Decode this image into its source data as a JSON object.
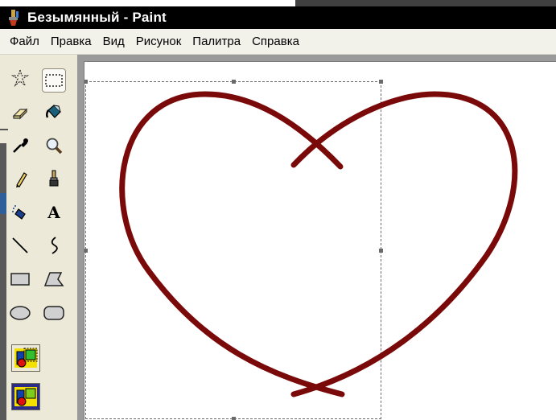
{
  "window": {
    "title": "Безымянный - Paint",
    "app_icon": "paint-icon"
  },
  "menu": {
    "items": [
      "Файл",
      "Правка",
      "Вид",
      "Рисунок",
      "Палитра",
      "Справка"
    ]
  },
  "toolbox": {
    "tools": [
      {
        "name": "free-form-select-icon",
        "selected": false
      },
      {
        "name": "rectangle-select-icon",
        "selected": true
      },
      {
        "name": "eraser-icon",
        "selected": false
      },
      {
        "name": "fill-bucket-icon",
        "selected": false
      },
      {
        "name": "color-picker-icon",
        "selected": false
      },
      {
        "name": "magnifier-icon",
        "selected": false
      },
      {
        "name": "pencil-icon",
        "selected": false
      },
      {
        "name": "brush-icon",
        "selected": false
      },
      {
        "name": "airbrush-icon",
        "selected": false
      },
      {
        "name": "text-tool-icon",
        "selected": false
      },
      {
        "name": "line-icon",
        "selected": false
      },
      {
        "name": "curve-icon",
        "selected": false
      },
      {
        "name": "rectangle-icon",
        "selected": false
      },
      {
        "name": "polygon-icon",
        "selected": false
      },
      {
        "name": "ellipse-icon",
        "selected": false
      },
      {
        "name": "rounded-rectangle-icon",
        "selected": false
      }
    ],
    "text_tool_glyph": "A",
    "selection_options": [
      {
        "name": "opaque-selection-icon",
        "selected": false
      },
      {
        "name": "transparent-selection-icon",
        "selected": true
      }
    ]
  },
  "canvas": {
    "drawing": "heart-outline",
    "stroke_color": "#7a0a0a",
    "background": "#ffffff",
    "selection_active": true
  }
}
